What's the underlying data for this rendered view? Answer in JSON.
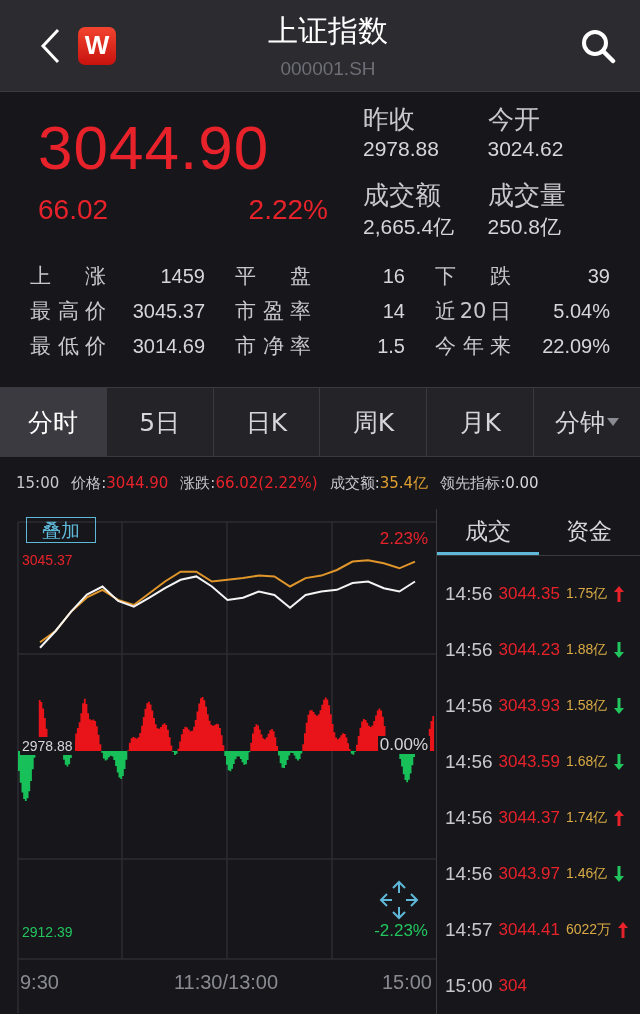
{
  "header": {
    "logo": "W",
    "title": "上证指数",
    "code": "000001.SH"
  },
  "quote": {
    "price": "3044.90",
    "change": "66.02",
    "change_pct": "2.22%",
    "fields": [
      {
        "label": "昨收",
        "value": "2978.88"
      },
      {
        "label": "今开",
        "value": "3024.62"
      },
      {
        "label": "成交额",
        "value": "2,665.4亿"
      },
      {
        "label": "成交量",
        "value": "250.8亿"
      }
    ]
  },
  "stats": [
    [
      {
        "label": "上 涨",
        "value": "1459"
      },
      {
        "label": "平 盘",
        "value": "16"
      },
      {
        "label": "下 跌",
        "value": "39"
      }
    ],
    [
      {
        "label": "最高价",
        "value": "3045.37"
      },
      {
        "label": "市盈率",
        "value": "14"
      },
      {
        "label": "近20日",
        "value": "5.04%"
      }
    ],
    [
      {
        "label": "最低价",
        "value": "3014.69"
      },
      {
        "label": "市净率",
        "value": "1.5"
      },
      {
        "label": "今年来",
        "value": "22.09%"
      }
    ]
  ],
  "tabs": [
    {
      "label": "分时",
      "selected": true
    },
    {
      "label": "5日",
      "selected": false
    },
    {
      "label": "日K",
      "selected": false
    },
    {
      "label": "周K",
      "selected": false
    },
    {
      "label": "月K",
      "selected": false
    },
    {
      "label": "分钟",
      "selected": false,
      "dropdown": true
    }
  ],
  "info": {
    "time": "15:00",
    "items": [
      {
        "label": "价格:",
        "value": "3044.90",
        "color": "#e8222a"
      },
      {
        "label": "涨跌:",
        "value": "66.02(2.22%)",
        "color": "#e8222a"
      },
      {
        "label": "成交额:",
        "value": "35.4亿",
        "color": "#e0a030"
      },
      {
        "label": "领先指标:",
        "value": "0.00",
        "color": "#d6d6da"
      }
    ]
  },
  "chart": {
    "overlay_button": "叠加",
    "high_pct": "2.23%",
    "base_pct": "0.00%",
    "low_pct": "-2.23%",
    "chart_data": {
      "type": "line",
      "categories": [
        "9:30",
        null,
        null,
        null,
        null,
        null,
        null,
        null,
        null,
        null,
        null,
        null,
        "11:30/13:00",
        null,
        null,
        null,
        null,
        null,
        null,
        null,
        null,
        null,
        null,
        null,
        "15:00"
      ],
      "series": [
        {
          "color": "#f4f4f4",
          "values": [
            3014,
            3020,
            3027,
            3033,
            3035.9,
            3030.7,
            3028.7,
            3031.9,
            3035.3,
            3038.3,
            3039.5,
            3035.9,
            3031.1,
            3031.9,
            3034.1,
            3032.9,
            3028.3,
            3032.9,
            3034.1,
            3034.7,
            3037.1,
            3037.7,
            3035.3,
            3034.1,
            3037.7
          ]
        },
        {
          "color": "#e0962a",
          "values": [
            3016,
            3020,
            3027,
            3032,
            3034.7,
            3031.1,
            3029.3,
            3033.5,
            3037.7,
            3041.2,
            3041.2,
            3037.7,
            3038.3,
            3038.9,
            3039.8,
            3039.5,
            3035.9,
            3038.9,
            3039.8,
            3041.8,
            3044.8,
            3045.3,
            3044.2,
            3042.4,
            3044.8
          ]
        }
      ],
      "ylim": [
        2912.39,
        3045.37
      ],
      "yticks": [
        {
          "value": 3045.37,
          "label": "3045.37"
        },
        {
          "value": 2978.88,
          "label": "2978.88"
        },
        {
          "value": 2912.39,
          "label": "2912.39"
        }
      ]
    }
  },
  "trade_tabs": [
    {
      "label": "成交",
      "selected": true
    },
    {
      "label": "资金",
      "selected": false
    }
  ],
  "trades": [
    {
      "time": "14:56",
      "price": "3044.35",
      "volume": "1.75亿",
      "up": true
    },
    {
      "time": "14:56",
      "price": "3044.23",
      "volume": "1.88亿",
      "up": false
    },
    {
      "time": "14:56",
      "price": "3043.93",
      "volume": "1.58亿",
      "up": false
    },
    {
      "time": "14:56",
      "price": "3043.59",
      "volume": "1.68亿",
      "up": false
    },
    {
      "time": "14:56",
      "price": "3044.37",
      "volume": "1.74亿",
      "up": true
    },
    {
      "time": "14:56",
      "price": "3043.97",
      "volume": "1.46亿",
      "up": false
    },
    {
      "time": "14:57",
      "price": "3044.41",
      "volume": "6022万",
      "up": true
    },
    {
      "time": "15:00",
      "price": "304"
    }
  ]
}
